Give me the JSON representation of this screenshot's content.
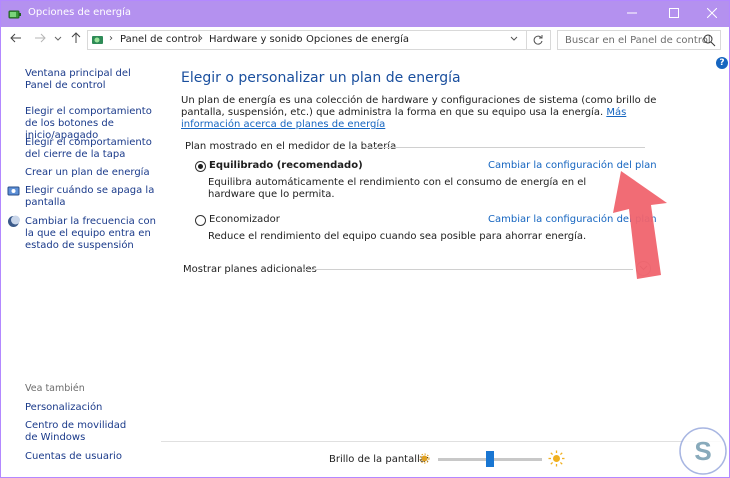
{
  "window": {
    "title": "Opciones de energía",
    "accent_color": "#b491ef",
    "minimize_icon": "minimize-icon",
    "maximize_icon": "maximize-icon",
    "close_icon": "close-icon"
  },
  "address": {
    "breadcrumbs": [
      "Panel de control",
      "Hardware y sonido",
      "Opciones de energía"
    ],
    "search_placeholder": "Buscar en el Panel de control"
  },
  "sidebar": {
    "links": [
      "Ventana principal del Panel de control",
      "Elegir el comportamiento de los botones de inicio/apagado",
      "Elegir el comportamiento del cierre de la tapa",
      "Crear un plan de energía",
      "Elegir cuándo se apaga la pantalla",
      "Cambiar la frecuencia con la que el equipo entra en estado de suspensión"
    ],
    "see_also_heading": "Vea también",
    "see_also": [
      "Personalización",
      "Centro de movilidad de Windows",
      "Cuentas de usuario"
    ]
  },
  "main": {
    "title": "Elegir o personalizar un plan de energía",
    "description": "Un plan de energía es una colección de hardware y configuraciones de sistema (como brillo de pantalla, suspensión, etc.) que administra la forma en que su equipo usa la energía.",
    "more_info_link": "Más información acerca de planes de energía",
    "plans_heading": "Plan mostrado en el medidor de la batería",
    "plans": [
      {
        "name": "Equilibrado (recomendado)",
        "selected": true,
        "link": "Cambiar la configuración del plan",
        "description": "Equilibra automáticamente el rendimiento con el consumo de energía en el hardware que lo permita."
      },
      {
        "name": "Economizador",
        "selected": false,
        "link": "Cambiar la configuración del plan",
        "description": "Reduce el rendimiento del equipo cuando sea posible para ahorrar energía."
      }
    ],
    "more_plans_label": "Mostrar planes adicionales"
  },
  "footer": {
    "brightness_label": "Brillo de la pantalla:",
    "brightness_level": 0.5
  }
}
